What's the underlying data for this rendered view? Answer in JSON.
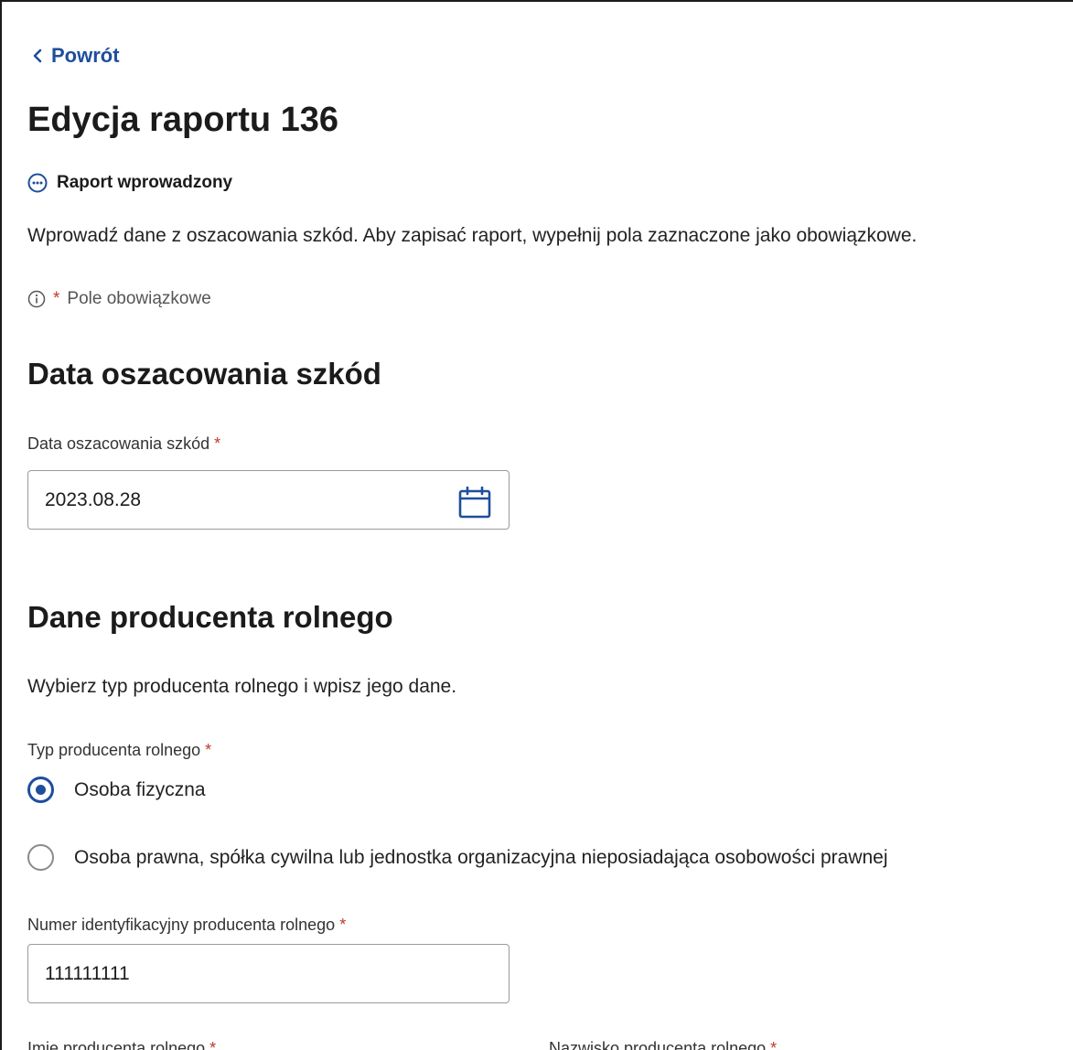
{
  "nav": {
    "back_label": "Powrót"
  },
  "page": {
    "title": "Edycja raportu 136",
    "status": "Raport wprowadzony",
    "intro": "Wprowadź dane z oszacowania szkód. Aby zapisać raport, wypełnij pola zaznaczone jako obowiązkowe.",
    "required_marker": "*",
    "required_note": "Pole obowiązkowe"
  },
  "section_damage_date": {
    "title": "Data oszacowania szkód",
    "field_label": "Data oszacowania szkód",
    "value": "2023.08.28"
  },
  "section_producer": {
    "title": "Dane producenta rolnego",
    "description": "Wybierz typ producenta rolnego i wpisz jego dane.",
    "type_label": "Typ producenta rolnego",
    "type_options": [
      {
        "label": "Osoba fizyczna",
        "selected": true
      },
      {
        "label": "Osoba prawna, spółka cywilna lub jednostka organizacyjna nieposiadająca osobowości prawnej",
        "selected": false
      }
    ],
    "id_label": "Numer identyfikacyjny producenta rolnego",
    "id_value": "111111111",
    "first_name_label": "Imię producenta rolnego",
    "last_name_label": "Nazwisko producenta rolnego"
  },
  "colors": {
    "accent": "#1f4e9c",
    "required": "#c0392b"
  }
}
